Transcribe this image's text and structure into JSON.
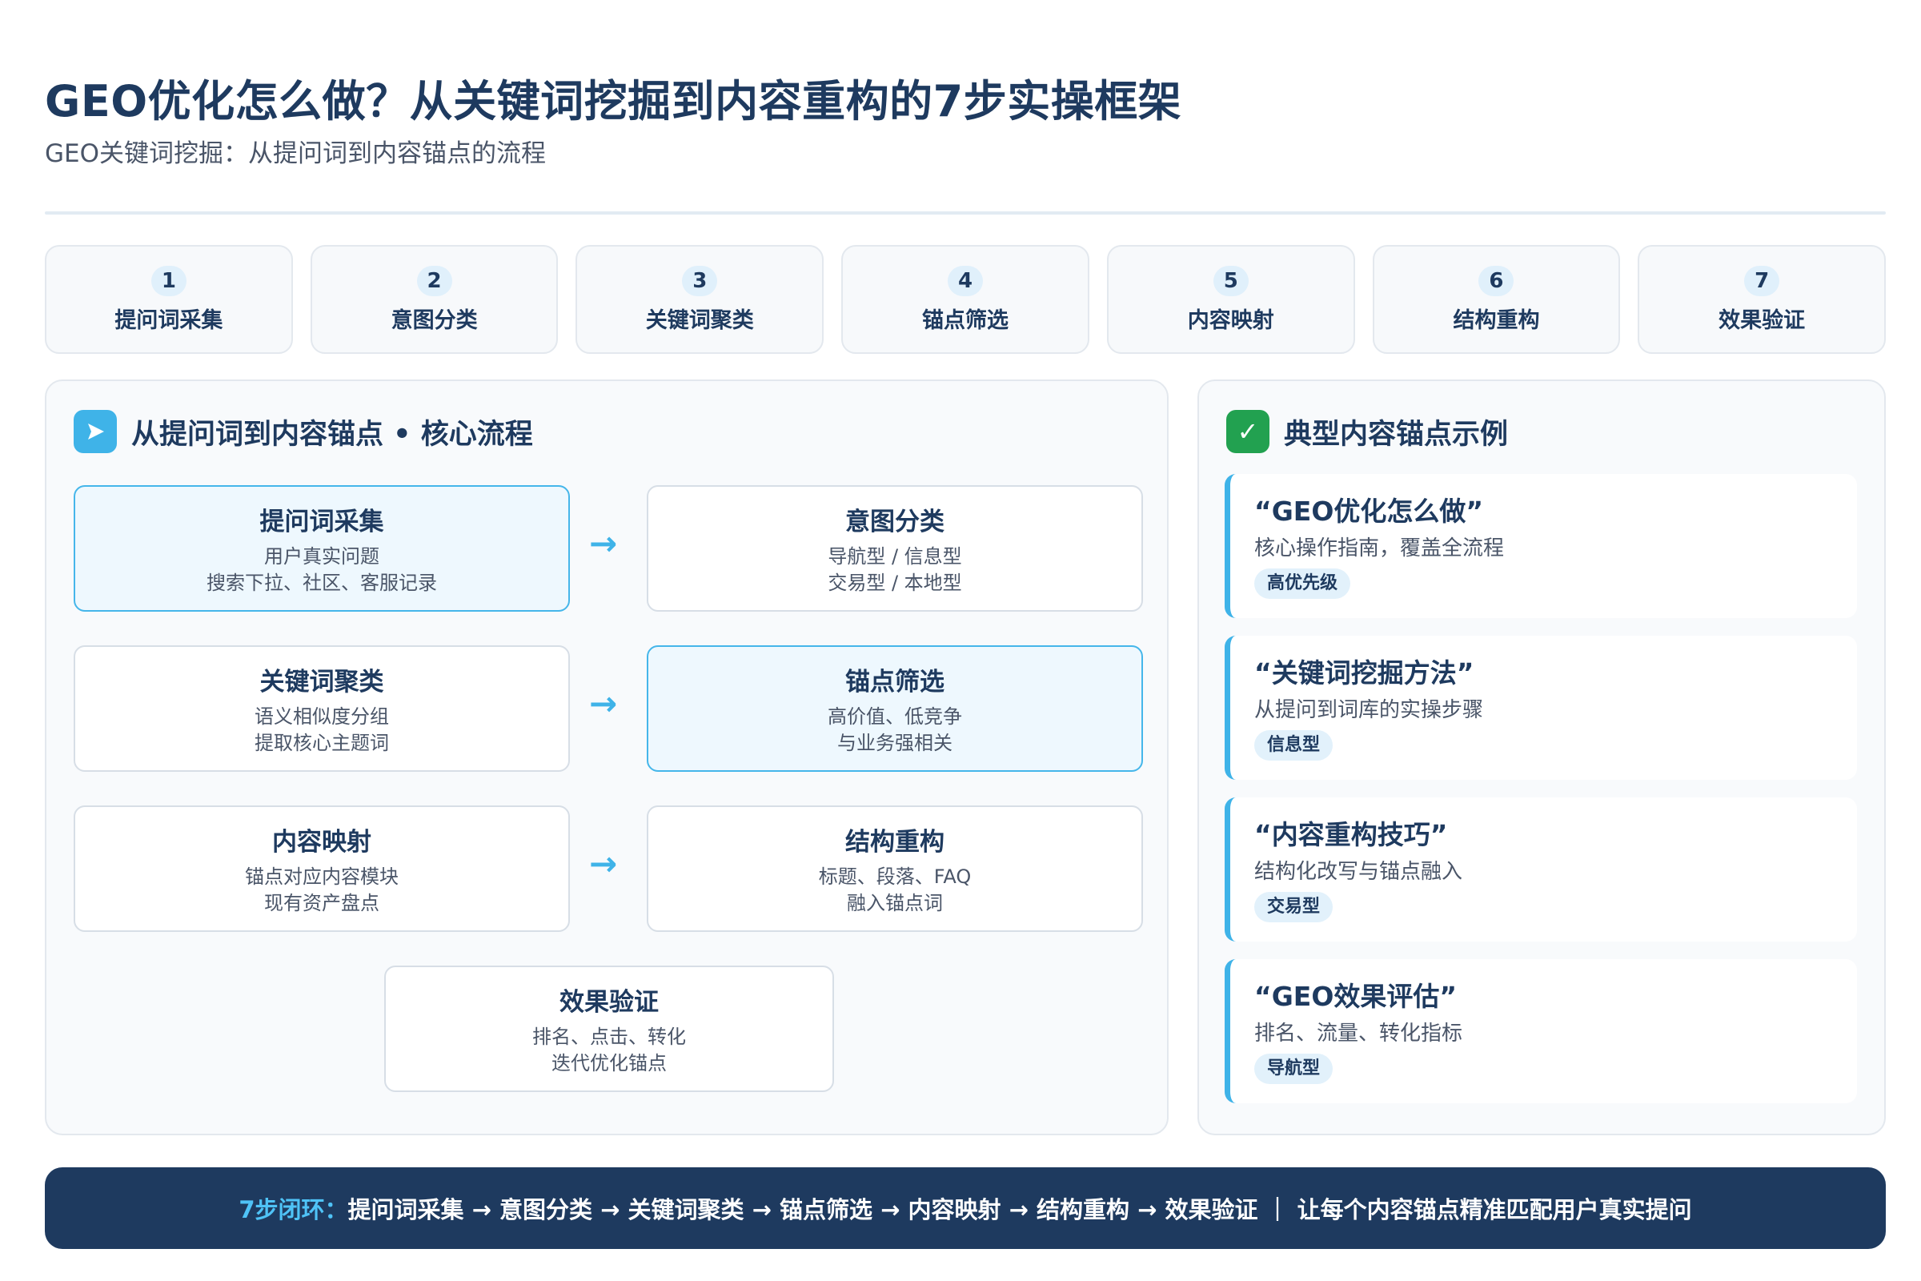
{
  "header": {
    "title": "GEO优化怎么做？从关键词挖掘到内容重构的7步实操框架",
    "subtitle": "GEO关键词挖掘：从提问词到内容锚点的流程"
  },
  "steps": [
    {
      "num": "1",
      "label": "提问词采集"
    },
    {
      "num": "2",
      "label": "意图分类"
    },
    {
      "num": "3",
      "label": "关键词聚类"
    },
    {
      "num": "4",
      "label": "锚点筛选"
    },
    {
      "num": "5",
      "label": "内容映射"
    },
    {
      "num": "6",
      "label": "结构重构"
    },
    {
      "num": "7",
      "label": "效果验证"
    }
  ],
  "flow": {
    "heading": "从提问词到内容锚点 • 核心流程",
    "icon": "play-arrow-icon",
    "arrow_glyph": "→",
    "nodes": [
      {
        "title": "提问词采集",
        "line1": "用户真实问题",
        "line2": "搜索下拉、社区、客服记录",
        "highlight": true
      },
      {
        "title": "意图分类",
        "line1": "导航型 / 信息型",
        "line2": "交易型 / 本地型",
        "highlight": false
      },
      {
        "title": "关键词聚类",
        "line1": "语义相似度分组",
        "line2": "提取核心主题词",
        "highlight": false
      },
      {
        "title": "锚点筛选",
        "line1": "高价值、低竞争",
        "line2": "与业务强相关",
        "highlight": true
      },
      {
        "title": "内容映射",
        "line1": "锚点对应内容模块",
        "line2": "现有资产盘点",
        "highlight": false
      },
      {
        "title": "结构重构",
        "line1": "标题、段落、FAQ",
        "line2": "融入锚点词",
        "highlight": false
      },
      {
        "title": "效果验证",
        "line1": "排名、点击、转化",
        "line2": "迭代优化锚点",
        "highlight": false
      }
    ]
  },
  "anchors": {
    "heading": "典型内容锚点示例",
    "icon": "check-icon",
    "check_glyph": "✓",
    "items": [
      {
        "title": "“GEO优化怎么做”",
        "desc": "核心操作指南，覆盖全流程",
        "tag": "高优先级"
      },
      {
        "title": "“关键词挖掘方法”",
        "desc": "从提问到词库的实操步骤",
        "tag": "信息型"
      },
      {
        "title": "“内容重构技巧”",
        "desc": "结构化改写与锚点融入",
        "tag": "交易型"
      },
      {
        "title": "“GEO效果评估”",
        "desc": "排名、流量、转化指标",
        "tag": "导航型"
      }
    ]
  },
  "footer": {
    "lead": "7步闭环：",
    "body": "提问词采集 → 意图分类 → 关键词聚类 → 锚点筛选 → 内容映射 → 结构重构 → 效果验证 ｜ 让每个内容锚点精准匹配用户真实提问"
  },
  "colors": {
    "primary": "#1e3a5f",
    "accent": "#3fb3e8",
    "success": "#22a150"
  }
}
